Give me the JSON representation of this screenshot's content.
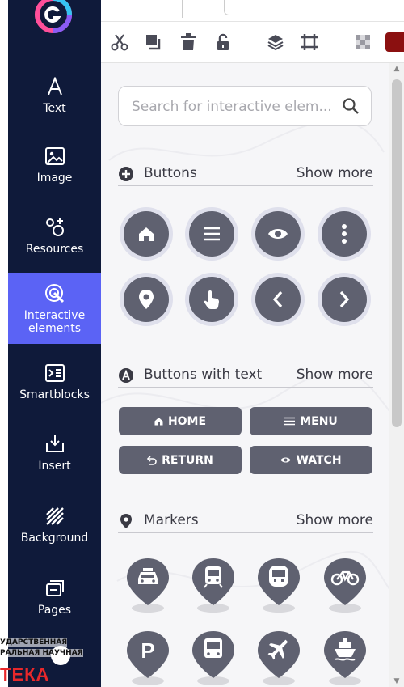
{
  "sidebar": {
    "items": [
      {
        "label": "Text"
      },
      {
        "label": "Image"
      },
      {
        "label": "Resources"
      },
      {
        "label": "Interactive elements",
        "active": true
      },
      {
        "label": "Smartblocks"
      },
      {
        "label": "Insert"
      },
      {
        "label": "Background"
      },
      {
        "label": "Pages"
      }
    ]
  },
  "watermark": {
    "line1": "УДАРСТВЕННАЯ",
    "line2": "РАЛЬНАЯ НАУЧНАЯ",
    "line3": "ТЕКА"
  },
  "toolbar": {
    "icons": [
      "scissors-icon",
      "duplicate-icon",
      "trash-icon",
      "unlock-icon",
      "layers-icon",
      "frame-icon",
      "transparency-icon",
      "color-swatch"
    ],
    "color_swatch": "#8b1010"
  },
  "search": {
    "placeholder": "Search for interactive elem..."
  },
  "sections": {
    "buttons": {
      "title": "Buttons",
      "more": "Show more"
    },
    "buttons_text": {
      "title": "Buttons with text",
      "more": "Show more"
    },
    "markers": {
      "title": "Markers",
      "more": "Show more"
    }
  },
  "icon_buttons": [
    "home-icon",
    "menu-icon",
    "eye-icon",
    "more-vertical-icon",
    "location-pin-icon",
    "touch-icon",
    "chevron-left-icon",
    "chevron-right-icon"
  ],
  "text_buttons": [
    {
      "label": "HOME",
      "icon": "home-icon"
    },
    {
      "label": "MENU",
      "icon": "menu-icon"
    },
    {
      "label": "RETURN",
      "icon": "return-icon"
    },
    {
      "label": "WATCH",
      "icon": "eye-icon"
    }
  ],
  "markers": [
    {
      "icon": "taxi-icon"
    },
    {
      "icon": "train-icon"
    },
    {
      "icon": "tram-icon"
    },
    {
      "icon": "bicycle-icon"
    },
    {
      "icon": "parking-icon",
      "text": "P"
    },
    {
      "icon": "bus-icon"
    },
    {
      "icon": "airplane-icon"
    },
    {
      "icon": "ship-icon"
    }
  ],
  "colors": {
    "sidebar": "#0f1a3a",
    "active": "#5b63f5",
    "button": "#5f6170",
    "button_ring": "#dfe0ec"
  }
}
